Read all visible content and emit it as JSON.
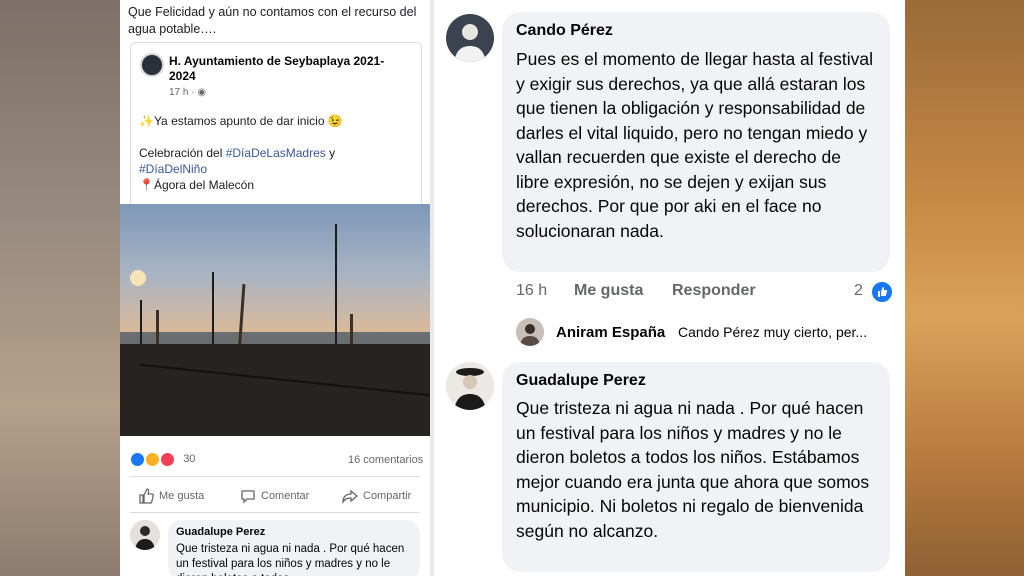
{
  "post": {
    "text": "Que Felicidad y aún no contamos con el recurso del agua potable….",
    "shared": {
      "page_name": "H. Ayuntamiento de Seybaplaya 2021-2024",
      "time": "17 h · ",
      "line1": "✨Ya estamos apunto de dar inicio 😉",
      "line2_prefix": "Celebración del ",
      "hashtag1": "#DíaDeLasMadres",
      "line2_suffix": " y",
      "hashtag2": "#DíaDelNiño",
      "place": "📍Ágora del Malecón"
    },
    "reaction_count": "30",
    "comments_count": "16 comentarios",
    "actions": {
      "like": "Me gusta",
      "comment": "Comentar",
      "share": "Compartir"
    },
    "mini_comment": {
      "name": "Guadalupe Perez",
      "text": "Que tristeza ni agua ni nada . Por qué hacen un festival para los niños y madres y no le dieron boletos a todos"
    }
  },
  "comments": [
    {
      "name": "Cando Pérez",
      "text": "Pues es el momento de llegar hasta al festival y exigir sus derechos, ya que allá estaran los que tienen la obligación y responsabilidad de darles el vital liquido, pero no tengan miedo y vallan recuerden que existe el derecho de libre expresión, no se dejen y exijan sus derechos. Por que por aki en el face no solucionaran nada.",
      "time": "16 h",
      "like": "Me gusta",
      "reply": "Responder",
      "likes": "2"
    },
    {
      "name": "Guadalupe Perez",
      "text": "Que tristeza ni agua ni nada . Por qué hacen un festival para los niños y madres y no le dieron boletos a todos los niños. Estábamos mejor cuando era junta que ahora que somos municipio. Ni boletos ni regalo de bienvenida según no alcanzo."
    }
  ],
  "reply_preview": {
    "name": "Aniram España",
    "text": "Cando Pérez muy cierto, per..."
  }
}
